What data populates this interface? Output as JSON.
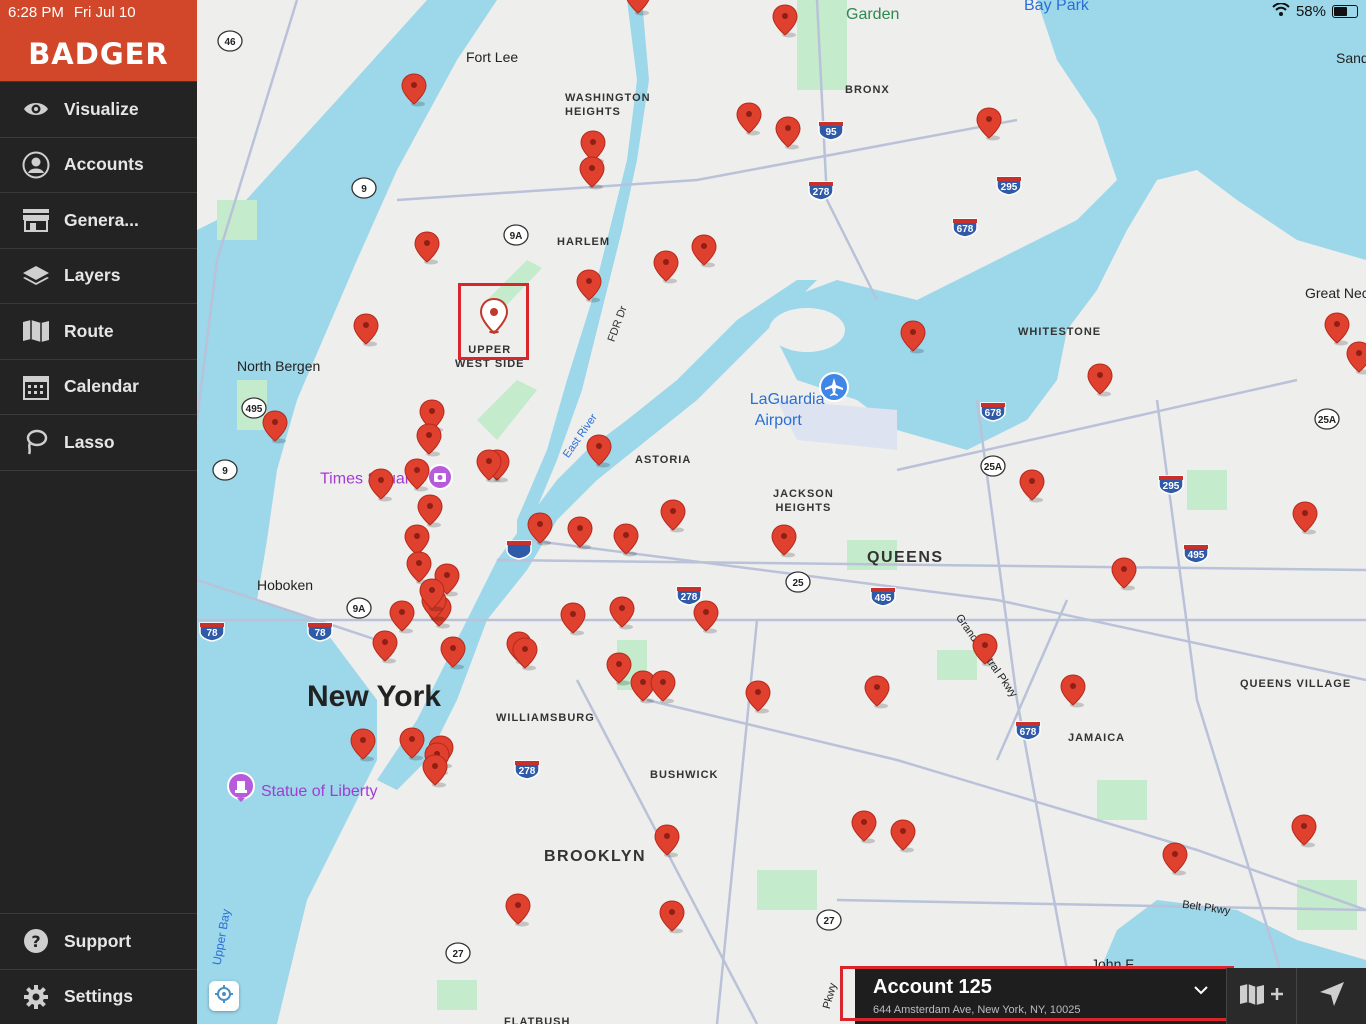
{
  "status": {
    "time": "6:28 PM",
    "date": "Fri Jul 10",
    "battery": "58%"
  },
  "brand": {
    "name": "BADGER"
  },
  "nav": {
    "items": [
      {
        "label": "Visualize",
        "icon": "eye-icon"
      },
      {
        "label": "Accounts",
        "icon": "person-icon"
      },
      {
        "label": "Genera...",
        "icon": "storefront-icon"
      },
      {
        "label": "Layers",
        "icon": "layers-icon"
      },
      {
        "label": "Route",
        "icon": "map-fold-icon"
      },
      {
        "label": "Calendar",
        "icon": "calendar-icon"
      },
      {
        "label": "Lasso",
        "icon": "lasso-icon"
      }
    ],
    "bottom": [
      {
        "label": "Support",
        "icon": "help-icon"
      },
      {
        "label": "Settings",
        "icon": "gear-icon"
      }
    ]
  },
  "map": {
    "labels": {
      "fort_lee": "Fort Lee",
      "washington_heights": "WASHINGTON\nHEIGHTS",
      "bronx": "BRONX",
      "harlem": "HARLEM",
      "upper_west_side": "UPPER\nWEST SIDE",
      "north_bergen": "North Bergen",
      "whitestone": "WHITESTONE",
      "astoria": "ASTORIA",
      "jackson_heights": "JACKSON\nHEIGHTS",
      "queens": "QUEENS",
      "hoboken": "Hoboken",
      "new_york": "New York",
      "williamsburg": "WILLIAMSBURG",
      "bushwick": "BUSHWICK",
      "brooklyn": "BROOKLYN",
      "jamaica": "JAMAICA",
      "queens_village": "QUEENS VILLAGE",
      "great_neck": "Great Nec",
      "sands": "Sand",
      "flatbush": "FLATBUSH",
      "john_f": "John F",
      "garden": "Garden",
      "bay_park": "Bay Park",
      "times_square": "Times Square",
      "statue_of_liberty": "Statue of Liberty",
      "laguardia": "LaGuardia\nAirport",
      "fdr": "FDR Dr",
      "east_river": "East River",
      "grand_central": "Grand Central Pkwy",
      "belt_pkwy": "Belt Pkwy",
      "upper_bay": "Upper Bay",
      "pkwy": "Pkwy"
    },
    "shields": [
      "46",
      "9",
      "9A",
      "495",
      "9",
      "9A",
      "78",
      "78",
      "95",
      "278",
      "295",
      "678",
      "678",
      "25A",
      "295",
      "495",
      "25",
      "278",
      "495",
      "678",
      "278",
      "27",
      "27",
      "25A"
    ]
  },
  "account": {
    "name": "Account 125",
    "address": "644 Amsterdam Ave, New York, NY, 10025"
  },
  "colors": {
    "brand": "#d2472a",
    "pin": "#e0402e",
    "water": "#9cd7ea",
    "highlight": "#d9262c"
  }
}
